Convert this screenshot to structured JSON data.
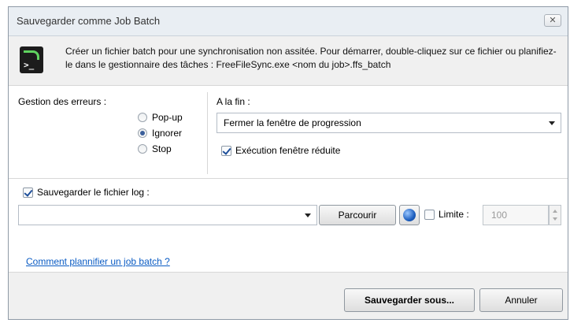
{
  "window": {
    "title": "Sauvegarder comme Job Batch",
    "close_icon": "✕"
  },
  "header": {
    "description": "Créer un fichier batch pour une synchronisation non assitée. Pour démarrer, double-cliquez sur ce fichier ou planifiez-le dans le gestionnaire des tâches : FreeFileSync.exe <nom du job>.ffs_batch",
    "icon": "terminal-icon"
  },
  "errors": {
    "label": "Gestion des erreurs :",
    "options": [
      "Pop-up",
      "Ignorer",
      "Stop"
    ],
    "selected": "Ignorer"
  },
  "finish": {
    "label": "A la fin :",
    "selected_option": "Fermer la fenêtre de progression",
    "minimized_label": "Exécution fenêtre réduite",
    "minimized_checked": true
  },
  "log": {
    "save_label": "Sauvegarder le fichier log :",
    "save_checked": true,
    "path_value": "",
    "browse_label": "Parcourir",
    "limit_label": "Limite :",
    "limit_checked": false,
    "limit_value": "100"
  },
  "help_link": "Comment plannifier un job batch ?",
  "buttons": {
    "save_as": "Sauvegarder sous...",
    "cancel": "Annuler"
  }
}
